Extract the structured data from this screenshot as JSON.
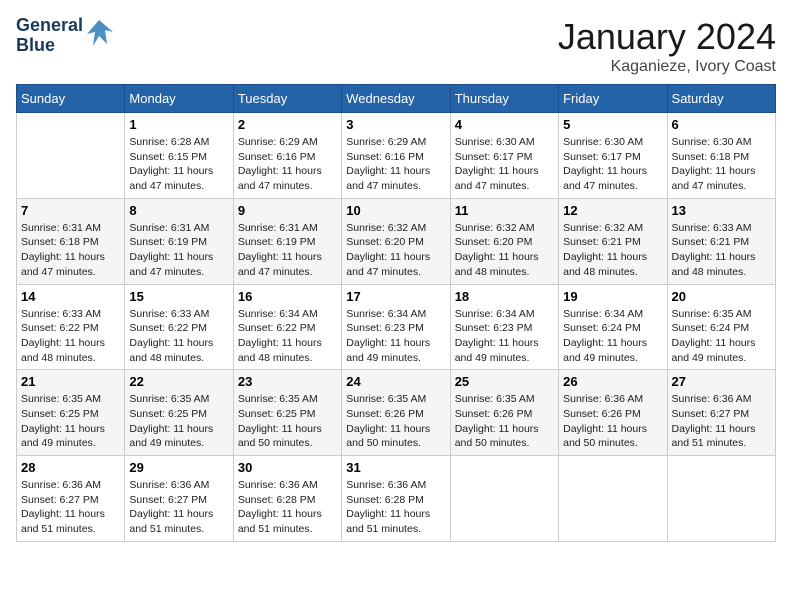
{
  "header": {
    "logo_line1": "General",
    "logo_line2": "Blue",
    "title": "January 2024",
    "subtitle": "Kaganieze, Ivory Coast"
  },
  "weekdays": [
    "Sunday",
    "Monday",
    "Tuesday",
    "Wednesday",
    "Thursday",
    "Friday",
    "Saturday"
  ],
  "weeks": [
    [
      {
        "day": "",
        "info": ""
      },
      {
        "day": "1",
        "info": "Sunrise: 6:28 AM\nSunset: 6:15 PM\nDaylight: 11 hours\nand 47 minutes."
      },
      {
        "day": "2",
        "info": "Sunrise: 6:29 AM\nSunset: 6:16 PM\nDaylight: 11 hours\nand 47 minutes."
      },
      {
        "day": "3",
        "info": "Sunrise: 6:29 AM\nSunset: 6:16 PM\nDaylight: 11 hours\nand 47 minutes."
      },
      {
        "day": "4",
        "info": "Sunrise: 6:30 AM\nSunset: 6:17 PM\nDaylight: 11 hours\nand 47 minutes."
      },
      {
        "day": "5",
        "info": "Sunrise: 6:30 AM\nSunset: 6:17 PM\nDaylight: 11 hours\nand 47 minutes."
      },
      {
        "day": "6",
        "info": "Sunrise: 6:30 AM\nSunset: 6:18 PM\nDaylight: 11 hours\nand 47 minutes."
      }
    ],
    [
      {
        "day": "7",
        "info": "Sunrise: 6:31 AM\nSunset: 6:18 PM\nDaylight: 11 hours\nand 47 minutes."
      },
      {
        "day": "8",
        "info": "Sunrise: 6:31 AM\nSunset: 6:19 PM\nDaylight: 11 hours\nand 47 minutes."
      },
      {
        "day": "9",
        "info": "Sunrise: 6:31 AM\nSunset: 6:19 PM\nDaylight: 11 hours\nand 47 minutes."
      },
      {
        "day": "10",
        "info": "Sunrise: 6:32 AM\nSunset: 6:20 PM\nDaylight: 11 hours\nand 47 minutes."
      },
      {
        "day": "11",
        "info": "Sunrise: 6:32 AM\nSunset: 6:20 PM\nDaylight: 11 hours\nand 48 minutes."
      },
      {
        "day": "12",
        "info": "Sunrise: 6:32 AM\nSunset: 6:21 PM\nDaylight: 11 hours\nand 48 minutes."
      },
      {
        "day": "13",
        "info": "Sunrise: 6:33 AM\nSunset: 6:21 PM\nDaylight: 11 hours\nand 48 minutes."
      }
    ],
    [
      {
        "day": "14",
        "info": "Sunrise: 6:33 AM\nSunset: 6:22 PM\nDaylight: 11 hours\nand 48 minutes."
      },
      {
        "day": "15",
        "info": "Sunrise: 6:33 AM\nSunset: 6:22 PM\nDaylight: 11 hours\nand 48 minutes."
      },
      {
        "day": "16",
        "info": "Sunrise: 6:34 AM\nSunset: 6:22 PM\nDaylight: 11 hours\nand 48 minutes."
      },
      {
        "day": "17",
        "info": "Sunrise: 6:34 AM\nSunset: 6:23 PM\nDaylight: 11 hours\nand 49 minutes."
      },
      {
        "day": "18",
        "info": "Sunrise: 6:34 AM\nSunset: 6:23 PM\nDaylight: 11 hours\nand 49 minutes."
      },
      {
        "day": "19",
        "info": "Sunrise: 6:34 AM\nSunset: 6:24 PM\nDaylight: 11 hours\nand 49 minutes."
      },
      {
        "day": "20",
        "info": "Sunrise: 6:35 AM\nSunset: 6:24 PM\nDaylight: 11 hours\nand 49 minutes."
      }
    ],
    [
      {
        "day": "21",
        "info": "Sunrise: 6:35 AM\nSunset: 6:25 PM\nDaylight: 11 hours\nand 49 minutes."
      },
      {
        "day": "22",
        "info": "Sunrise: 6:35 AM\nSunset: 6:25 PM\nDaylight: 11 hours\nand 49 minutes."
      },
      {
        "day": "23",
        "info": "Sunrise: 6:35 AM\nSunset: 6:25 PM\nDaylight: 11 hours\nand 50 minutes."
      },
      {
        "day": "24",
        "info": "Sunrise: 6:35 AM\nSunset: 6:26 PM\nDaylight: 11 hours\nand 50 minutes."
      },
      {
        "day": "25",
        "info": "Sunrise: 6:35 AM\nSunset: 6:26 PM\nDaylight: 11 hours\nand 50 minutes."
      },
      {
        "day": "26",
        "info": "Sunrise: 6:36 AM\nSunset: 6:26 PM\nDaylight: 11 hours\nand 50 minutes."
      },
      {
        "day": "27",
        "info": "Sunrise: 6:36 AM\nSunset: 6:27 PM\nDaylight: 11 hours\nand 51 minutes."
      }
    ],
    [
      {
        "day": "28",
        "info": "Sunrise: 6:36 AM\nSunset: 6:27 PM\nDaylight: 11 hours\nand 51 minutes."
      },
      {
        "day": "29",
        "info": "Sunrise: 6:36 AM\nSunset: 6:27 PM\nDaylight: 11 hours\nand 51 minutes."
      },
      {
        "day": "30",
        "info": "Sunrise: 6:36 AM\nSunset: 6:28 PM\nDaylight: 11 hours\nand 51 minutes."
      },
      {
        "day": "31",
        "info": "Sunrise: 6:36 AM\nSunset: 6:28 PM\nDaylight: 11 hours\nand 51 minutes."
      },
      {
        "day": "",
        "info": ""
      },
      {
        "day": "",
        "info": ""
      },
      {
        "day": "",
        "info": ""
      }
    ]
  ]
}
